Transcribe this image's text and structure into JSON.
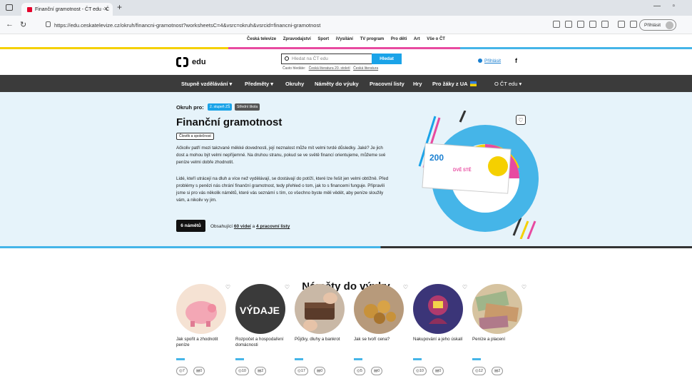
{
  "browser": {
    "tab_title": "Finanční gramotnost - ČT edu - Č",
    "url": "https://edu.ceskatelevize.cz/okruh/financni-gramotnost?worksheetsC=4&vsrc=okruh&vsrcid=financni-gramotnost",
    "signin_label": "Přihlásit"
  },
  "toplinks": [
    "Česká televize",
    "Zpravodajství",
    "Sport",
    "iVysílání",
    "TV program",
    "Pro děti",
    "Art",
    "Vše o ČT"
  ],
  "header": {
    "logo_text": "edu",
    "search_placeholder": "Hledat na ČT edu",
    "search_button": "Hledat",
    "hint_label": "Často hledáte:",
    "hint_1": "Česká literatura 20. století",
    "hint_2": "Česká literatura",
    "login": "Přihlásit",
    "facebook": "f"
  },
  "nav": {
    "items": [
      "Stupně vzdělávání ▾",
      "Předměty ▾",
      "Okruhy",
      "Náměty do výuky",
      "Pracovní listy",
      "Hry",
      "Pro žáky z UA",
      "O ČT edu ▾"
    ]
  },
  "hero": {
    "okruh_label": "Okruh pro:",
    "badge_1": "2. stupeň ZŠ",
    "badge_2": "Střední škola",
    "title": "Finanční gramotnost",
    "tag": "Člověk a společnost",
    "para_1": "Ačkoliv patří mezi takzvané měkké dovednosti, její neznalost může mít velmi tvrdé důsledky. Jaké? Je jich dost a mohou být velmi nepříjemné. Na druhou stranu, pokud se ve světě financí orientujeme, můžeme své peníze velmi dobře zhodnotit.",
    "para_2": "Lidé, kteří utrácejí na dluh a více než vydělávají, se dostávají do potíží, které lze řešit jen velmi obtížně. Před problémy s penězi nás chrání finanční gramotnost, tedy přehled o tom, jak to s financemi funguje. Připravili jsme si pro vás několik námětů, které vás seznámí s tím, co všechno byste měli vědět, aby peníze sloužily vám, a nikoliv vy jim.",
    "count_button": "6 námětů",
    "contains_label": "Obsahující",
    "videos_link": "60 videí",
    "and": "a",
    "worksheets_link": "4 pracovní listy",
    "banknote_value": "200",
    "banknote_text": "DVĚ STĚ"
  },
  "section": {
    "title": "Náměty do výuky",
    "cards": [
      {
        "title": "Jak spořit a zhodnotit peníze",
        "videos": "7",
        "sheets": "0"
      },
      {
        "title": "Rozpočet a hospodaření domácnosti",
        "videos": "10",
        "sheets": "2"
      },
      {
        "title": "Půjčky, dluhy a bankrot",
        "videos": "17",
        "sheets": "0"
      },
      {
        "title": "Jak se tvoří cena?",
        "videos": "5",
        "sheets": "0"
      },
      {
        "title": "Nakupování a jeho úskalí",
        "videos": "10",
        "sheets": "0"
      },
      {
        "title": "Peníze a placení",
        "videos": "12",
        "sheets": "2"
      }
    ],
    "card_image_texts": [
      "VÝDAJE"
    ]
  },
  "colors": {
    "accent_blue": "#1aa3e8",
    "nav_bg": "#3b3b3b",
    "hero_bg": "#e6f3fa",
    "stripe_yellow": "#f5d000",
    "stripe_pink": "#e84aa0",
    "stripe_blue": "#45b5e8"
  }
}
